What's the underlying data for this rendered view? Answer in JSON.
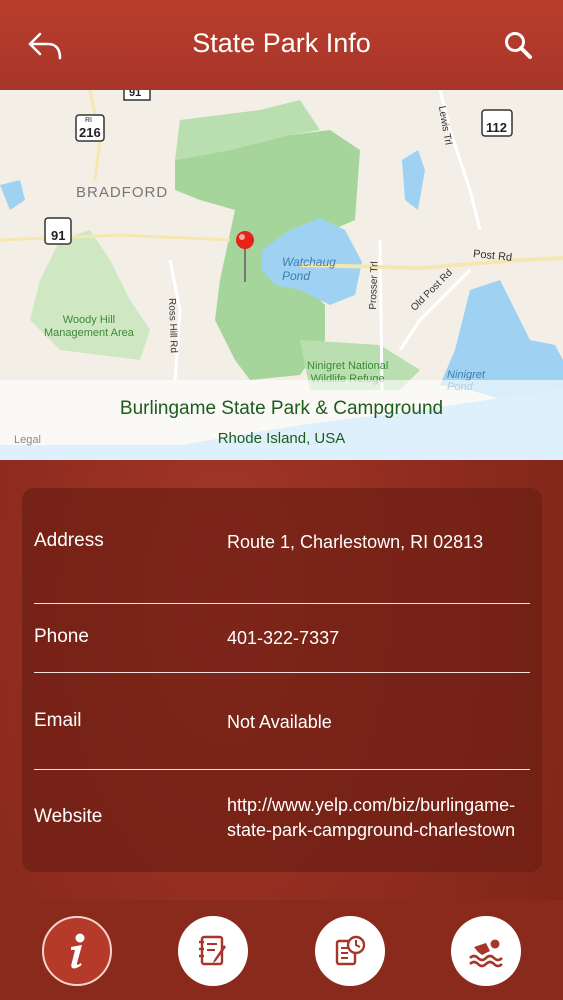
{
  "header": {
    "title": "State Park Info"
  },
  "map": {
    "park_name": "Burlingame State Park & Campground",
    "region": "Rhode Island, USA",
    "legal": "Legal",
    "labels": {
      "town": "BRADFORD",
      "pond": "Watchaug\nPond",
      "woody_hill": "Woody Hill\nManagement Area",
      "ninigret_refuge": "Ninigret National\nWildlife Refuge",
      "ninigret_pond": "Ninigret\nPond",
      "post_rd": "Post Rd",
      "old_post_rd": "Old Post Rd",
      "prosser_trl": "Prosser Trl",
      "ross_hill_rd": "Ross Hill Rd",
      "lewis_trl": "Lewis Trl",
      "shield_91_top": "91",
      "shield_216": "216",
      "shield_91": "91",
      "shield_112": "112",
      "shield_ri": "RI"
    }
  },
  "info": {
    "address_label": "Address",
    "address_value": "Route 1, Charlestown, RI 02813",
    "phone_label": "Phone",
    "phone_value": "401-322-7337",
    "email_label": "Email",
    "email_value": "Not Available",
    "website_label": "Website",
    "website_value_line1": "http://www.yelp.com/biz/burlingame-",
    "website_value_line2": "state-park-campground-charlestown"
  },
  "colors": {
    "header": "#b93e2c",
    "background": "#8e2a1c",
    "park_text": "#1d5c1d",
    "map_green": "#a6d59b",
    "water": "#9fd2f2"
  },
  "tabs": [
    {
      "icon": "info-icon",
      "active": true
    },
    {
      "icon": "notes-icon",
      "active": false
    },
    {
      "icon": "schedule-icon",
      "active": false
    },
    {
      "icon": "swimming-icon",
      "active": false
    }
  ]
}
